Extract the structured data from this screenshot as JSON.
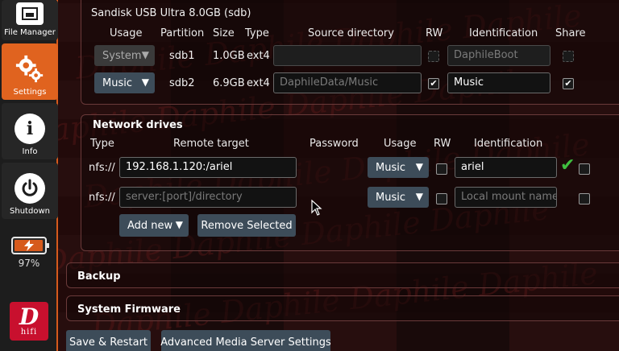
{
  "sidebar": {
    "items": [
      {
        "label": "File Manager",
        "icon": "folder-icon",
        "active": false
      },
      {
        "label": "Settings",
        "icon": "gears-icon",
        "active": true
      },
      {
        "label": "Info",
        "icon": "info-icon",
        "active": false
      },
      {
        "label": "Shutdown",
        "icon": "power-icon",
        "active": false
      }
    ],
    "battery_percent": "97%",
    "battery_level": 0.97,
    "logo": {
      "letter": "D",
      "text": "hifi"
    }
  },
  "drive_panel": {
    "device_title": "Sandisk USB Ultra 8.0GB (sdb)",
    "headers": {
      "usage": "Usage",
      "partition": "Partition",
      "size": "Size",
      "type": "Type",
      "source": "Source directory",
      "rw": "RW",
      "identification": "Identification",
      "share": "Share"
    },
    "rows": [
      {
        "usage": "System",
        "partition": "sdb1",
        "size": "1.0GB",
        "type": "ext4",
        "source": "",
        "rw": false,
        "identification": "DaphileBoot",
        "share": false,
        "disabled": true
      },
      {
        "usage": "Music",
        "partition": "sdb2",
        "size": "6.9GB",
        "type": "ext4",
        "source_placeholder": "DaphileData/Music",
        "rw": true,
        "identification": "Music",
        "share": true,
        "disabled": false
      }
    ]
  },
  "network_panel": {
    "title": "Network drives",
    "headers": {
      "type": "Type",
      "remote": "Remote target",
      "password": "Password",
      "usage": "Usage",
      "rw": "RW",
      "identification": "Identification"
    },
    "rows": [
      {
        "type": "nfs://",
        "remote": "192.168.1.120:/ariel",
        "usage": "Music",
        "rw": false,
        "identification": "ariel",
        "status_ok": true,
        "selected": false
      },
      {
        "type": "nfs://",
        "remote_placeholder": "server:[port]/directory",
        "usage": "Music",
        "rw": false,
        "identification_placeholder": "Local mount name",
        "selected": false
      }
    ],
    "add_new_label": "Add new",
    "remove_selected_label": "Remove Selected"
  },
  "backup_panel": {
    "title": "Backup"
  },
  "firmware_panel": {
    "title": "System Firmware"
  },
  "footer": {
    "save_restart_label": "Save & Restart",
    "advanced_label": "Advanced Media Server Settings"
  },
  "colors": {
    "accent": "#e0631f",
    "button": "#3d4c59",
    "ok": "#3fbf3f",
    "logo": "#c8102e"
  }
}
